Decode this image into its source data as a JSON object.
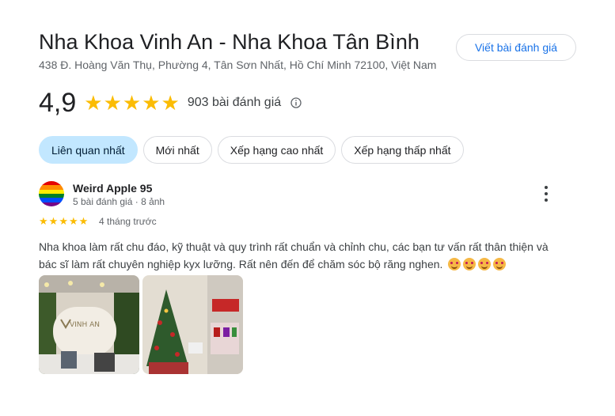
{
  "place": {
    "name": "Nha Khoa Vinh An - Nha Khoa Tân Bình",
    "address": "438 Đ. Hoàng Văn Thụ, Phường 4, Tân Sơn Nhất, Hồ Chí Minh 72100, Việt Nam",
    "write_review_label": "Viết bài đánh giá"
  },
  "summary": {
    "rating": "4,9",
    "stars": 5,
    "review_count": "903 bài đánh giá",
    "info_icon": "info-icon"
  },
  "filters": [
    {
      "label": "Liên quan nhất",
      "active": true
    },
    {
      "label": "Mới nhất",
      "active": false
    },
    {
      "label": "Xếp hạng cao nhất",
      "active": false
    },
    {
      "label": "Xếp hạng thấp nhất",
      "active": false
    }
  ],
  "review": {
    "author": "Weird Apple 95",
    "meta": "5 bài đánh giá · 8 ảnh",
    "stars": 5,
    "date": "4 tháng trước",
    "text": "Nha khoa làm rất chu đáo, kỹ thuật và quy trình rất chuẩn và chỉnh chu, các bạn tư vấn rất thân thiện và bác sĩ làm rất chuyên nghiệp kyx lưỡng. Rất nên đến để chăm sóc bộ răng nghen.",
    "emoji_count": 4,
    "photos": [
      {
        "name": "clinic-reception-photo",
        "logo_text": "VINH AN"
      },
      {
        "name": "christmas-tree-photo"
      }
    ]
  },
  "colors": {
    "star": "#fbbc04",
    "accent": "#1a73e8",
    "active_chip": "#c2e7ff"
  }
}
